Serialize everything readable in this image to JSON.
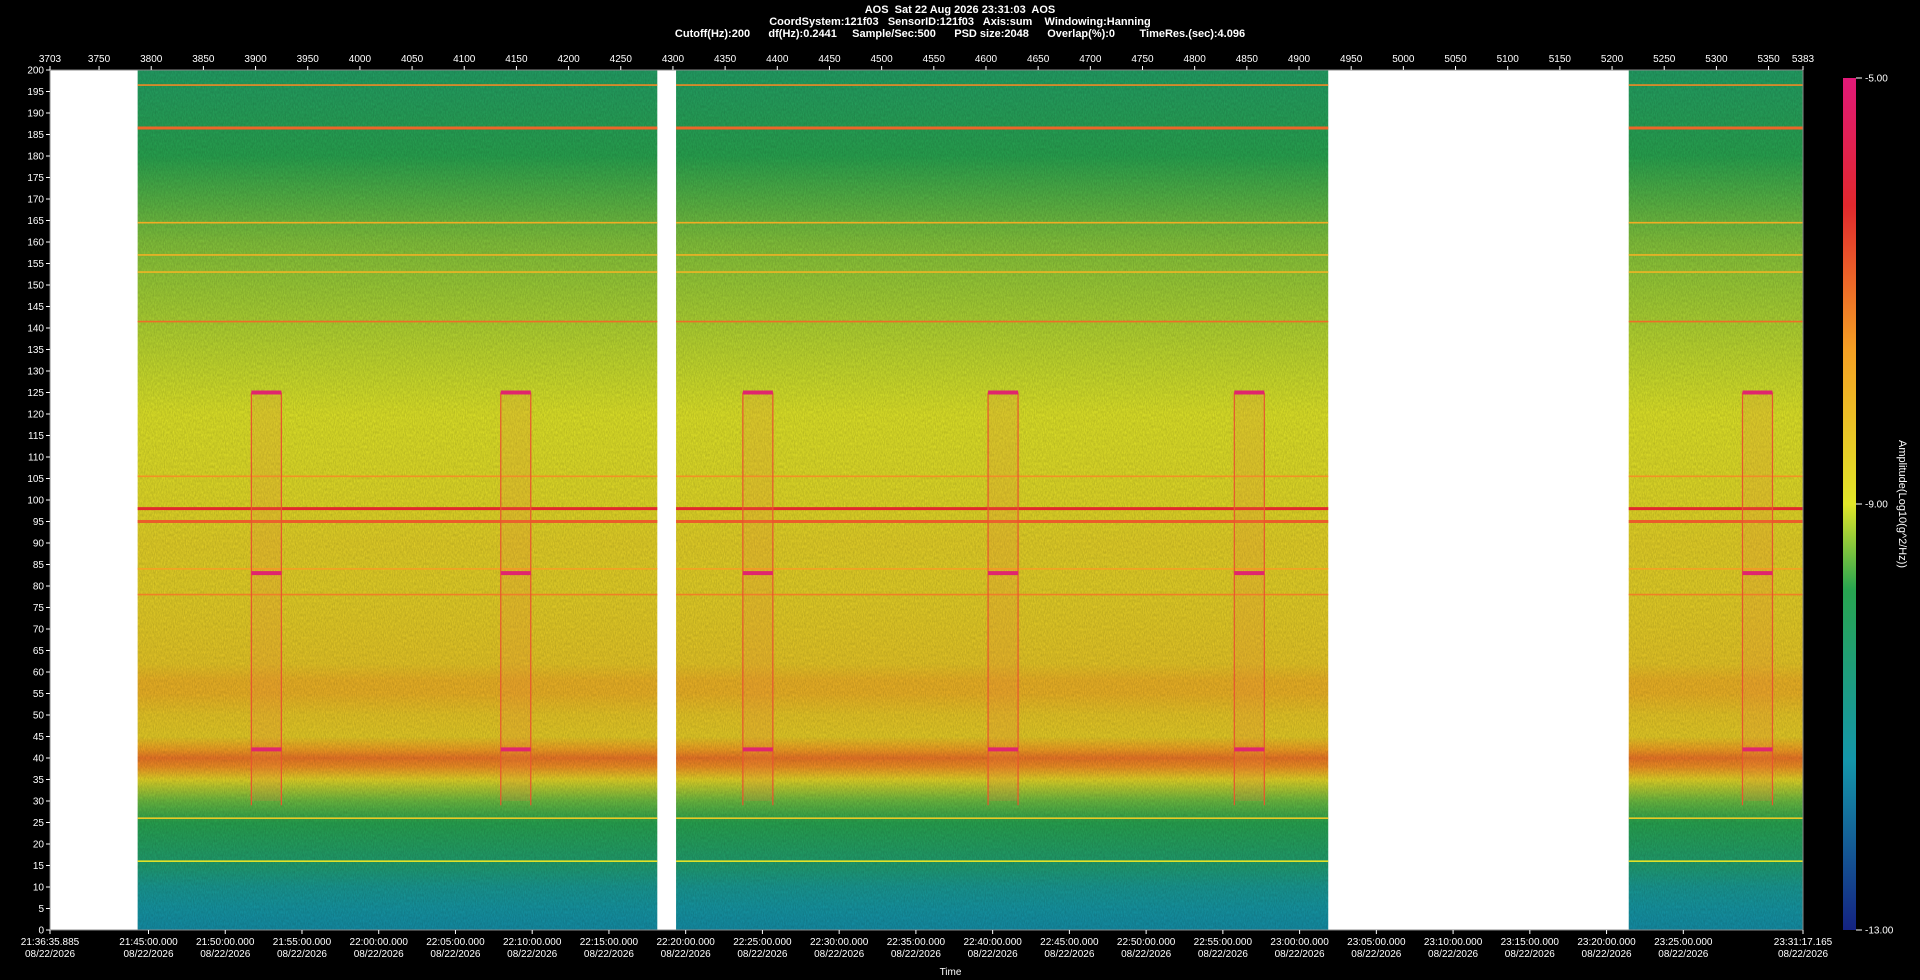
{
  "header": {
    "line1": "AOS  Sat 22 Aug 2026 23:31:03  AOS",
    "line2": "CoordSystem:121f03   SensorID:121f03   Axis:sum    Windowing:Hanning",
    "line3": "Cutoff(Hz):200      df(Hz):0.2441     Sample/Sec:500      PSD size:2048      Overlap(%):0        TimeRes.(sec):4.096"
  },
  "chart_data": {
    "type": "heatmap",
    "title": "AOS  Sat 22 Aug 2026 23:31:03  AOS",
    "xlabel": "Time",
    "ylabel": "",
    "colorbar_label": "Amplitude(Log10(g^2/Hz))",
    "colorbar_ticks": [
      "-5.00",
      "-9.00",
      "-13.00"
    ],
    "colorbar_range": [
      -13,
      -5
    ],
    "ylim": [
      0,
      200
    ],
    "y_ticks": [
      0,
      5,
      10,
      15,
      20,
      25,
      30,
      35,
      40,
      45,
      50,
      55,
      60,
      65,
      70,
      75,
      80,
      85,
      90,
      95,
      100,
      105,
      110,
      115,
      120,
      125,
      130,
      135,
      140,
      145,
      150,
      155,
      160,
      165,
      170,
      175,
      180,
      185,
      190,
      195,
      200
    ],
    "frame_range": [
      3703,
      5383
    ],
    "frame_ticks": [
      "3703",
      "3750",
      "3800",
      "3850",
      "3900",
      "3950",
      "4000",
      "4050",
      "4100",
      "4150",
      "4200",
      "4250",
      "4300",
      "4350",
      "4400",
      "4450",
      "4500",
      "4550",
      "4600",
      "4650",
      "4700",
      "4750",
      "4800",
      "4850",
      "4900",
      "4950",
      "5000",
      "5050",
      "5100",
      "5150",
      "5200",
      "5250",
      "5300",
      "5350",
      "5383"
    ],
    "time_ticks": [
      [
        "21:36:35.885",
        "08/22/2026"
      ],
      [
        "21:45:00.000",
        "08/22/2026"
      ],
      [
        "21:50:00.000",
        "08/22/2026"
      ],
      [
        "21:55:00.000",
        "08/22/2026"
      ],
      [
        "22:00:00.000",
        "08/22/2026"
      ],
      [
        "22:05:00.000",
        "08/22/2026"
      ],
      [
        "22:10:00.000",
        "08/22/2026"
      ],
      [
        "22:15:00.000",
        "08/22/2026"
      ],
      [
        "22:20:00.000",
        "08/22/2026"
      ],
      [
        "22:25:00.000",
        "08/22/2026"
      ],
      [
        "22:30:00.000",
        "08/22/2026"
      ],
      [
        "22:35:00.000",
        "08/22/2026"
      ],
      [
        "22:40:00.000",
        "08/22/2026"
      ],
      [
        "22:45:00.000",
        "08/22/2026"
      ],
      [
        "22:50:00.000",
        "08/22/2026"
      ],
      [
        "22:55:00.000",
        "08/22/2026"
      ],
      [
        "23:00:00.000",
        "08/22/2026"
      ],
      [
        "23:05:00.000",
        "08/22/2026"
      ],
      [
        "23:10:00.000",
        "08/22/2026"
      ],
      [
        "23:15:00.000",
        "08/22/2026"
      ],
      [
        "23:20:00.000",
        "08/22/2026"
      ],
      [
        "23:25:00.000",
        "08/22/2026"
      ],
      [
        "23:31:17.165",
        "08/22/2026"
      ]
    ],
    "data_segments": [
      {
        "frame_start": 3787,
        "frame_end": 4285
      },
      {
        "frame_start": 4303,
        "frame_end": 4928
      },
      {
        "frame_start": 5216,
        "frame_end": 5389
      }
    ],
    "frequency_profile_hz_vs_log10": [
      [
        0,
        -11.5
      ],
      [
        5,
        -11.3
      ],
      [
        10,
        -11.0
      ],
      [
        15,
        -10.4
      ],
      [
        20,
        -10.1
      ],
      [
        25,
        -9.8
      ],
      [
        30,
        -9.5
      ],
      [
        35,
        -8.7
      ],
      [
        38,
        -7.4
      ],
      [
        40,
        -7.1
      ],
      [
        42,
        -7.6
      ],
      [
        45,
        -8.5
      ],
      [
        50,
        -8.4
      ],
      [
        55,
        -8.0
      ],
      [
        58,
        -8.0
      ],
      [
        62,
        -8.4
      ],
      [
        70,
        -8.5
      ],
      [
        80,
        -8.6
      ],
      [
        90,
        -8.6
      ],
      [
        100,
        -8.8
      ],
      [
        110,
        -8.9
      ],
      [
        120,
        -9.0
      ],
      [
        130,
        -9.1
      ],
      [
        140,
        -9.2
      ],
      [
        150,
        -9.3
      ],
      [
        160,
        -9.4
      ],
      [
        170,
        -9.6
      ],
      [
        180,
        -9.8
      ],
      [
        190,
        -10.0
      ],
      [
        200,
        -10.2
      ]
    ],
    "tonal_lines_hz": [
      {
        "hz": 98.0,
        "level": -6.2
      },
      {
        "hz": 95.0,
        "level": -6.8
      },
      {
        "hz": 186.5,
        "level": -6.9
      },
      {
        "hz": 141.5,
        "level": -7.0
      },
      {
        "hz": 196.5,
        "level": -7.3
      },
      {
        "hz": 105.5,
        "level": -7.4
      },
      {
        "hz": 78.0,
        "level": -7.2
      },
      {
        "hz": 84.0,
        "level": -7.6
      },
      {
        "hz": 164.5,
        "level": -7.8
      },
      {
        "hz": 157.0,
        "level": -7.9
      },
      {
        "hz": 153.0,
        "level": -8.0
      },
      {
        "hz": 26.0,
        "level": -8.4
      },
      {
        "hz": 16.0,
        "level": -8.9
      }
    ],
    "events_frames": [
      3896,
      4135,
      4367,
      4602,
      4838,
      5325
    ],
    "event_tones_hz": [
      125,
      83,
      42
    ]
  }
}
